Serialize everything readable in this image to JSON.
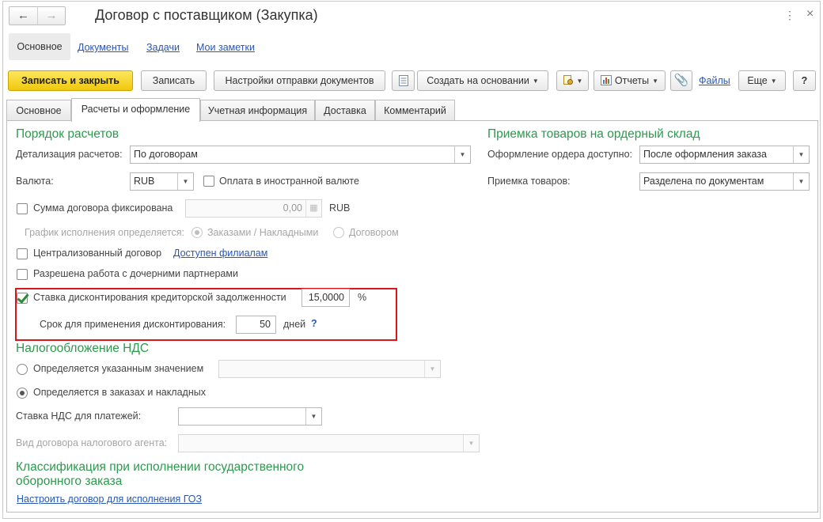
{
  "window": {
    "title": "Договор с поставщиком (Закупка)",
    "back_icon": "←",
    "forward_icon": "→",
    "more_icon": "⋮",
    "close_icon": "×"
  },
  "section_nav": {
    "active": "Основное",
    "links": [
      "Документы",
      "Задачи",
      "Мои заметки"
    ]
  },
  "toolbar": {
    "save_close": "Записать и закрыть",
    "save": "Записать",
    "send_settings": "Настройки отправки документов",
    "create_based_on": "Создать на основании",
    "reports": "Отчеты",
    "files": "Файлы",
    "more": "Еще",
    "help": "?"
  },
  "tabs": [
    "Основное",
    "Расчеты и оформление",
    "Учетная информация",
    "Доставка",
    "Комментарий"
  ],
  "active_tab": 1,
  "settlement": {
    "title": "Порядок расчетов",
    "detail_label": "Детализация расчетов:",
    "detail_value": "По договорам",
    "currency_label": "Валюта:",
    "currency_value": "RUB",
    "foreign_currency_label": "Оплата в иностранной валюте",
    "foreign_currency_checked": false,
    "fixed_sum_label": "Сумма договора фиксирована",
    "fixed_sum_checked": false,
    "fixed_sum_value": "0,00",
    "fixed_sum_currency": "RUB",
    "schedule_label": "График исполнения определяется:",
    "schedule_options": [
      "Заказами / Накладными",
      "Договором"
    ],
    "schedule_selected": 0,
    "centralized_label": "Централизованный договор",
    "centralized_checked": false,
    "branches_link": "Доступен филиалам",
    "subsidiaries_label": "Разрешена работа с дочерними партнерами",
    "subsidiaries_checked": false,
    "discount_label": "Ставка дисконтирования кредиторской задолженности",
    "discount_checked": true,
    "discount_value": "15,0000",
    "discount_unit": "%",
    "discount_term_label": "Срок для применения дисконтирования:",
    "discount_term_value": "50",
    "discount_term_unit": "дней",
    "help_mark": "?"
  },
  "warehouse": {
    "title": "Приемка товаров на ордерный склад",
    "order_label": "Оформление ордера доступно:",
    "order_value": "После оформления заказа",
    "receipt_label": "Приемка товаров:",
    "receipt_value": "Разделена по документам"
  },
  "vat": {
    "title": "Налогообложение НДС",
    "option1": "Определяется указанным значением",
    "option2": "Определяется в заказах и накладных",
    "selected": 1,
    "payment_rate_label": "Ставка НДС для платежей:",
    "payment_rate_value": "",
    "tax_agent_label": "Вид договора налогового агента:",
    "tax_agent_value": ""
  },
  "goz": {
    "title_line1": "Классификация при исполнении государственного",
    "title_line2": "оборонного заказа",
    "link": "Настроить договор для исполнения ГОЗ"
  },
  "colors": {
    "accent_green": "#2c9a4d",
    "link_blue": "#2957b4",
    "primary_button": "#f5d320",
    "highlight_red": "#d9161b"
  }
}
